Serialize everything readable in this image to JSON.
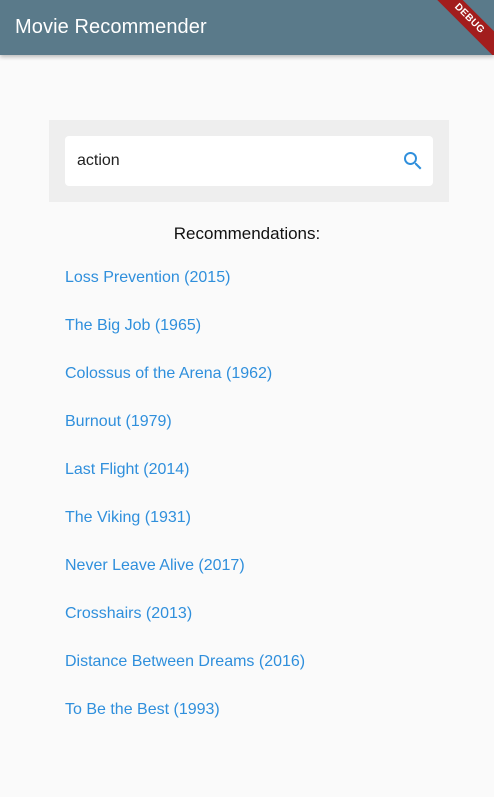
{
  "app_bar": {
    "title": "Movie Recommender",
    "debug_label": "DEBUG"
  },
  "search": {
    "value": "action",
    "icon": "search-icon"
  },
  "recommendations": {
    "heading": "Recommendations:",
    "items": [
      {
        "label": "Loss Prevention (2015)"
      },
      {
        "label": "The Big Job (1965)"
      },
      {
        "label": "Colossus of the Arena (1962)"
      },
      {
        "label": "Burnout (1979)"
      },
      {
        "label": "Last Flight (2014)"
      },
      {
        "label": "The Viking (1931)"
      },
      {
        "label": "Never Leave Alive (2017)"
      },
      {
        "label": "Crosshairs (2013)"
      },
      {
        "label": "Distance Between Dreams (2016)"
      },
      {
        "label": "To Be the Best (1993)"
      }
    ]
  },
  "colors": {
    "app_bar": "#5a7a8a",
    "link": "#2f8fdc",
    "search_icon": "#2f8fdc",
    "debug_ribbon": "#a21d1d"
  }
}
